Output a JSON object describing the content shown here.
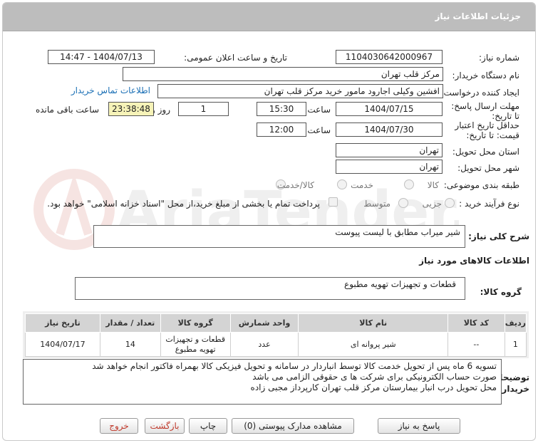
{
  "header": {
    "title": "جزئیات اطلاعات نیاز"
  },
  "fields": {
    "need_number_label": "شماره نیاز:",
    "need_number": "1104030642000967",
    "announce_label": "تاریخ و ساعت اعلان عمومی:",
    "announce_value": "1404/07/13 - 14:47",
    "buyer_org_label": "نام دستگاه خریدار:",
    "buyer_org": "مرکز قلب تهران",
    "creator_label": "ایجاد کننده درخواست:",
    "creator": "افشین وکیلی اجارود مامور خرید مرکز قلب تهران",
    "contact_link": "اطلاعات تماس خریدار",
    "reply_deadline_label": "مهلت ارسال پاسخ: تا تاریخ:",
    "reply_date": "1404/07/15",
    "time_label": "ساعت",
    "reply_time": "15:30",
    "days_value": "1",
    "days_label": "روز و",
    "remaining_time": "23:38:48",
    "remaining_label": "ساعت باقی مانده",
    "price_validity_label": "حداقل تاریخ اعتبار قیمت: تا تاریخ:",
    "price_date": "1404/07/30",
    "price_time": "12:00",
    "province_label": "استان محل تحویل:",
    "province": "تهران",
    "city_label": "شهر محل تحویل:",
    "city": "تهران",
    "category_label": "طبقه بندی موضوعی:",
    "category_options": [
      "کالا",
      "خدمت",
      "کالا/خدمت"
    ],
    "process_label": "نوع فرآیند خرید :",
    "process_options": [
      "جزیی",
      "متوسط"
    ],
    "payment_note": "پرداخت تمام یا بخشی از مبلغ خرید،از محل \"اسناد خزانه اسلامی\" خواهد بود."
  },
  "summary": {
    "label": "شرح کلی نیاز:",
    "value": "شیر میراب مطابق با لیست پیوست"
  },
  "goods": {
    "section_title": "اطلاعات کالاهای مورد نیاز",
    "group_label": "گروه کالا:",
    "group_value": "قطعات و تجهیزات تهویه مطبوع",
    "columns": [
      "ردیف",
      "کد کالا",
      "نام کالا",
      "واحد شمارش",
      "گروه کالا",
      "تعداد / مقدار",
      "تاریخ نیاز"
    ],
    "rows": [
      {
        "row": "1",
        "code": "--",
        "name": "شیر پروانه ای",
        "unit": "عدد",
        "group": "قطعات و تجهیزات تهویه مطبوع",
        "qty": "14",
        "date": "1404/07/17"
      }
    ]
  },
  "notes": {
    "label": "توضیحات خریدار:",
    "lines": [
      "تسویه 6 ماه پس از تحویل خدمت کالا توسط انباردار در سامانه و تحویل فیزیکی کالا بهمراه فاکتور انجام خواهد شد",
      "صورت حساب الکترونیکی برای شرکت ها ی حقوقی الزامی می باشد",
      "محل تحویل درب انبار بیمارستان مرکز قلب تهران کارپرداز مجبی زاده"
    ]
  },
  "buttons": {
    "reply": "پاسخ به نیاز",
    "attachments": "مشاهده مدارک پیوستی (0)",
    "print": "چاپ",
    "back": "بازگشت",
    "exit": "خروج"
  },
  "watermark": {
    "text": "AriaTender.net"
  },
  "colors": {
    "titlebar": "#bdbdbd",
    "link": "#1a6fb5",
    "remaining_bg": "#f6f3b8"
  }
}
